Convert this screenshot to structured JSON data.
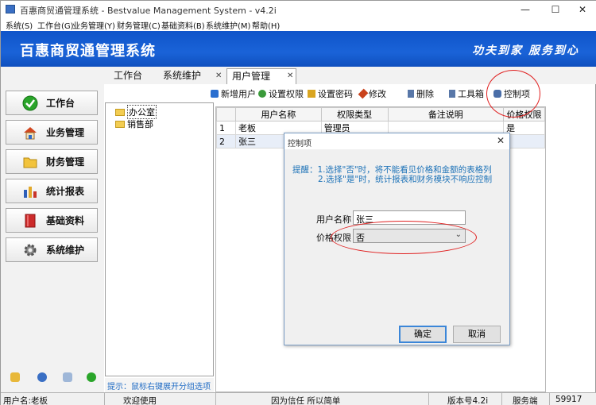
{
  "window": {
    "title": "百惠商贸通管理系统 - Bestvalue Management System - v4.2i",
    "minimize": "—",
    "maximize": "☐",
    "close": "✕"
  },
  "menu": [
    "系统(S)",
    "工作台(G)",
    "业务管理(Y)",
    "财务管理(C)",
    "基础资料(B)",
    "系统维护(M)",
    "帮助(H)"
  ],
  "banner": {
    "app_title": "百惠商贸通管理系统",
    "slogan": "功夫到家 服务到心"
  },
  "nav": [
    {
      "label": "工作台",
      "icon": "check-circle-icon",
      "color": "#2aa52a"
    },
    {
      "label": "业务管理",
      "icon": "house-icon",
      "color": "#d2461e"
    },
    {
      "label": "财务管理",
      "icon": "folder-icon",
      "color": "#f2c33c"
    },
    {
      "label": "统计报表",
      "icon": "bar-chart-icon",
      "color": "#2f5fb8"
    },
    {
      "label": "基础资料",
      "icon": "book-icon",
      "color": "#cc2a2a"
    },
    {
      "label": "系统维护",
      "icon": "gear-icon",
      "color": "#7a7a7a"
    }
  ],
  "tabs": [
    {
      "label": "工作台",
      "closable": false
    },
    {
      "label": "系统维护",
      "closable": true
    },
    {
      "label": "用户管理",
      "closable": true,
      "active": true
    }
  ],
  "toolbar": [
    {
      "label": "新增用户",
      "icon": "plus-icon",
      "color": "#2a6fd0"
    },
    {
      "label": "设置权限",
      "icon": "shield-icon",
      "color": "#3a9a3a"
    },
    {
      "label": "设置密码",
      "icon": "lock-icon",
      "color": "#d9a520"
    },
    {
      "label": "修改",
      "icon": "edit-icon",
      "color": "#c9421c"
    },
    {
      "label": "删除",
      "icon": "trash-icon",
      "color": "#5877a8"
    },
    {
      "label": "工具箱",
      "icon": "toolbox-icon",
      "color": "#5877a8"
    },
    {
      "label": "控制项",
      "icon": "control-icon",
      "color": "#4a6ea8"
    }
  ],
  "tree": [
    {
      "label": "办公室",
      "selected": true
    },
    {
      "label": "销售部",
      "selected": false
    }
  ],
  "hint": "提示：鼠标右键展开分组选项",
  "grid": {
    "columns": [
      "",
      "用户名称",
      "权限类型",
      "备注说明",
      "价格权限"
    ],
    "rows": [
      [
        "1",
        "老板",
        "管理员",
        "",
        "是"
      ],
      [
        "2",
        "张三",
        "",
        "",
        ""
      ]
    ]
  },
  "dialog": {
    "title": "控制项",
    "close": "✕",
    "tip_line1": "提醒：1.选择\"否\"时，将不能看见价格和金额的表格列",
    "tip_line2": "2.选择\"是\"时，统计报表和财务模块不响应控制",
    "username_label": "用户名称",
    "username_value": "张三",
    "price_label": "价格权限",
    "price_value": "否",
    "ok": "确定",
    "cancel": "取消"
  },
  "status": {
    "user": "用户名:老板",
    "welcome": "欢迎使用",
    "motto": "因为信任 所以简单",
    "version": "版本号4.2i",
    "server": "服务端",
    "port": "59917"
  }
}
